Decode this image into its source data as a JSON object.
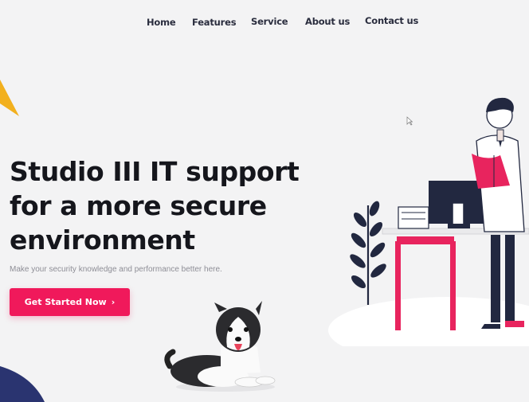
{
  "nav": {
    "items": [
      {
        "label": "Home"
      },
      {
        "label": "Features"
      },
      {
        "label": "Service"
      },
      {
        "label": "About us"
      },
      {
        "label": "Contact us"
      }
    ]
  },
  "hero": {
    "title_lines": [
      "Studio III IT support",
      "for a more secure",
      "environment"
    ],
    "subtitle": "Make your security knowledge and performance better here.",
    "cta_label": "Get Started Now",
    "cta_icon": "chevron-right-icon"
  },
  "colors": {
    "accent": "#f0195b",
    "background": "#f3f3f4",
    "navy": "#1f2544",
    "yellow": "#f2b01e"
  }
}
